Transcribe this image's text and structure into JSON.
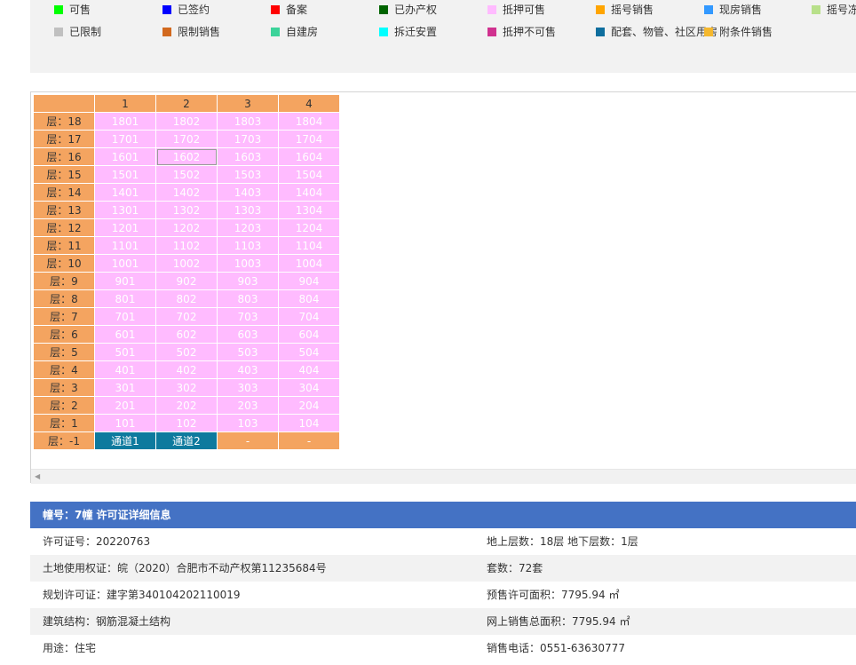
{
  "legend": [
    {
      "label": "可售",
      "color": "#00ff00"
    },
    {
      "label": "已签约",
      "color": "#0000ff"
    },
    {
      "label": "备案",
      "color": "#ff0000"
    },
    {
      "label": "已办产权",
      "color": "#006400"
    },
    {
      "label": "抵押可售",
      "color": "#ffbbff"
    },
    {
      "label": "摇号销售",
      "color": "#ffa500"
    },
    {
      "label": "现房销售",
      "color": "#3399ff"
    },
    {
      "label": "摇号冻",
      "color": "#b8e08a"
    },
    {
      "label": "已限制",
      "color": "#c0c0c0"
    },
    {
      "label": "限制销售",
      "color": "#d2691e"
    },
    {
      "label": "自建房",
      "color": "#3cd39a"
    },
    {
      "label": "拆迁安置",
      "color": "#00ffff"
    },
    {
      "label": "抵押不可售",
      "color": "#d0318f"
    },
    {
      "label": "配套、物管、社区用房",
      "color": "#0e6e9e"
    },
    {
      "label": "附条件销售",
      "color": "#f5b82e"
    }
  ],
  "grid": {
    "columns": [
      "1",
      "2",
      "3",
      "4"
    ],
    "floors": [
      {
        "label": "层：18",
        "units": [
          "1801",
          "1802",
          "1803",
          "1804"
        ]
      },
      {
        "label": "层：17",
        "units": [
          "1701",
          "1702",
          "1703",
          "1704"
        ]
      },
      {
        "label": "层：16",
        "units": [
          "1601",
          "1602",
          "1603",
          "1604"
        ]
      },
      {
        "label": "层：15",
        "units": [
          "1501",
          "1502",
          "1503",
          "1504"
        ]
      },
      {
        "label": "层：14",
        "units": [
          "1401",
          "1402",
          "1403",
          "1404"
        ]
      },
      {
        "label": "层：13",
        "units": [
          "1301",
          "1302",
          "1303",
          "1304"
        ]
      },
      {
        "label": "层：12",
        "units": [
          "1201",
          "1202",
          "1203",
          "1204"
        ]
      },
      {
        "label": "层：11",
        "units": [
          "1101",
          "1102",
          "1103",
          "1104"
        ]
      },
      {
        "label": "层：10",
        "units": [
          "1001",
          "1002",
          "1003",
          "1004"
        ]
      },
      {
        "label": "层：9",
        "units": [
          "901",
          "902",
          "903",
          "904"
        ]
      },
      {
        "label": "层：8",
        "units": [
          "801",
          "802",
          "803",
          "804"
        ]
      },
      {
        "label": "层：7",
        "units": [
          "701",
          "702",
          "703",
          "704"
        ]
      },
      {
        "label": "层：6",
        "units": [
          "601",
          "602",
          "603",
          "604"
        ]
      },
      {
        "label": "层：5",
        "units": [
          "501",
          "502",
          "503",
          "504"
        ]
      },
      {
        "label": "层：4",
        "units": [
          "401",
          "402",
          "403",
          "404"
        ]
      },
      {
        "label": "层：3",
        "units": [
          "301",
          "302",
          "303",
          "304"
        ]
      },
      {
        "label": "层：2",
        "units": [
          "201",
          "202",
          "203",
          "204"
        ]
      },
      {
        "label": "层：1",
        "units": [
          "101",
          "102",
          "103",
          "104"
        ]
      }
    ],
    "basement": {
      "label": "层：-1",
      "units": [
        "通道1",
        "通道2",
        "-",
        "-"
      ]
    }
  },
  "info": {
    "title": "幢号：7幢 许可证详细信息",
    "rows": [
      {
        "left": "许可证号：20220763",
        "right": "地上层数：18层  地下层数：1层"
      },
      {
        "left": "土地使用权证：皖（2020）合肥市不动产权第11235684号",
        "right": "套数：72套"
      },
      {
        "left": "规划许可证：建字第340104202110019",
        "right": "预售许可面积：7795.94 ㎡"
      },
      {
        "left": "建筑结构：钢筋混凝土结构",
        "right": "网上销售总面积：7795.94 ㎡"
      },
      {
        "left": "用途：住宅",
        "right": "销售电话：0551-63630777"
      }
    ]
  }
}
